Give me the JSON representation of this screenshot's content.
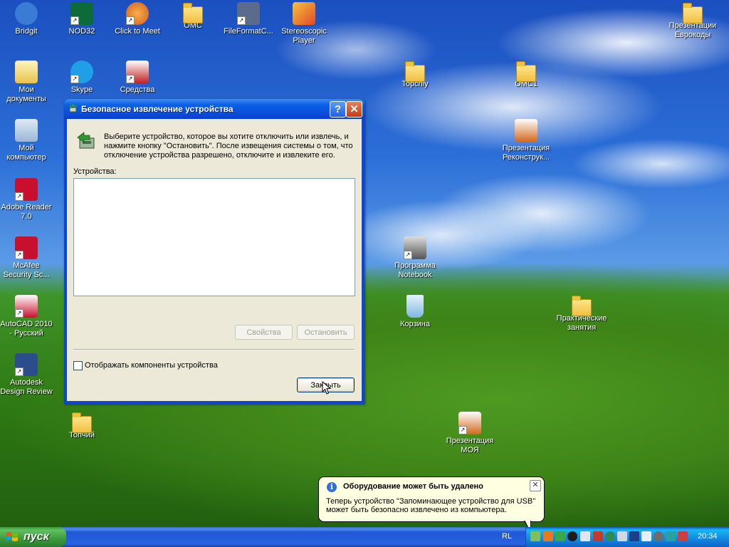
{
  "desktop": {
    "icons": [
      {
        "label": "Bridgit",
        "icon": "bridgit-icon",
        "color": "#3a7bd5"
      },
      {
        "label": "NOD32",
        "icon": "nod32-icon",
        "color": "#0d6b3a"
      },
      {
        "label": "Click to Meet",
        "icon": "click-to-meet-icon",
        "color": "#d25a1e"
      },
      {
        "label": "OMC",
        "icon": "folder-icon"
      },
      {
        "label": "FileFormatC...",
        "icon": "file-format-converter-icon",
        "color": "#5a6b8c"
      },
      {
        "label": "Stereoscopic Player",
        "icon": "stereoscopic-player-icon",
        "color": "#e04a2a"
      },
      {
        "label": "Презентации Еврокоды",
        "icon": "folder-icon"
      },
      {
        "label": "Мои документы",
        "icon": "my-documents-icon",
        "color": "#e8c34a"
      },
      {
        "label": "Skype",
        "icon": "skype-icon",
        "color": "#1ea0e6"
      },
      {
        "label": "Средства",
        "icon": "smart-tools-icon",
        "color": "#c22020"
      },
      {
        "label": "Topchiy",
        "icon": "folder-icon"
      },
      {
        "label": "OMC1",
        "icon": "folder-icon"
      },
      {
        "label": "Мой компьютер",
        "icon": "my-computer-icon",
        "color": "#9bb7d6"
      },
      {
        "label": "Презентация Реконструк...",
        "icon": "powerpoint-icon",
        "color": "#d2691e"
      },
      {
        "label": "Adobe Reader 7.0",
        "icon": "adobe-reader-icon",
        "color": "#c8102e"
      },
      {
        "label": "McAfee Security Sc...",
        "icon": "mcafee-icon",
        "color": "#c8102e"
      },
      {
        "label": "Программа Notebook",
        "icon": "smart-notebook-icon",
        "color": "#555555"
      },
      {
        "label": "AutoCAD 2010 - Русский",
        "icon": "autocad-icon",
        "color": "#c8102e"
      },
      {
        "label": "Корзина",
        "icon": "recycle-bin-icon",
        "color": "#7fb8e0"
      },
      {
        "label": "Практические занятия",
        "icon": "folder-icon"
      },
      {
        "label": "Autodesk Design Review",
        "icon": "design-review-icon",
        "color": "#2b4d8c"
      },
      {
        "label": "Топчий",
        "icon": "folder-icon"
      },
      {
        "label": "Презентация МОЯ",
        "icon": "powerpoint-icon",
        "color": "#d2691e"
      }
    ]
  },
  "dialog": {
    "title": "Безопасное извлечение устройства",
    "help_label": "?",
    "close_label": "✕",
    "description": "Выберите устройство, которое вы хотите отключить или извлечь, и нажмите кнопку \"Остановить\". После извещения системы о том, что отключение устройства разрешено, отключите и извлеките его.",
    "devices_label": "Устройства:",
    "properties_button": "Свойства",
    "stop_button": "Остановить",
    "show_components_label": "Отображать компоненты устройства",
    "show_components_checked": false,
    "close_button": "Закрыть"
  },
  "balloon": {
    "title": "Оборудование может быть удалено",
    "text": "Теперь устройство \"Запоминающее устройство для USB\" может быть безопасно извлечено из компьютера.",
    "close_label": "✕",
    "info_glyph": "i"
  },
  "taskbar": {
    "start_label": "пуск",
    "language": "RL",
    "clock": "20:34",
    "tray_icons": [
      "safely-remove-hardware-icon",
      "java-icon",
      "network-icon",
      "webcam-icon",
      "display-icon",
      "antivirus-icon",
      "audio-icon",
      "sound-icon",
      "monitor-icon",
      "network-connection-icon",
      "smart-board-icon",
      "update-icon",
      "security-icon"
    ]
  },
  "colors": {
    "titlebar": "#0a4ad6",
    "dialog_face": "#ece9d8",
    "start_button": "#3c9a3c",
    "balloon_bg": "#ffffe1"
  }
}
